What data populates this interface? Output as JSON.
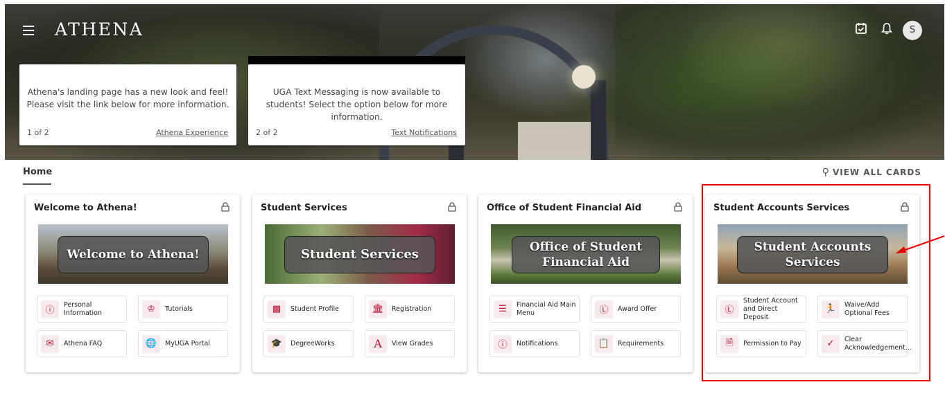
{
  "header": {
    "brand": "ATHENA",
    "avatar_initial": "S"
  },
  "announcements": [
    {
      "message": "Athena's landing page has a new look and feel! Please visit the link below for more information.",
      "count": "1 of 2",
      "link": "Athena Experience"
    },
    {
      "message": "UGA Text Messaging is now available to students! Select the option below for more information.",
      "count": "2 of 2",
      "link": "Text Notifications"
    }
  ],
  "tabs": {
    "home": "Home",
    "view_all": "VIEW ALL CARDS"
  },
  "accent_color": "#ba0c2f",
  "cards": [
    {
      "title": "Welcome to Athena!",
      "banner": "Welcome to Athena!",
      "links": [
        {
          "label": "Personal Information",
          "icon": "info-icon"
        },
        {
          "label": "Tutorials",
          "icon": "tutorial-icon"
        },
        {
          "label": "Athena FAQ",
          "icon": "chat-icon"
        },
        {
          "label": "MyUGA Portal",
          "icon": "globe-icon"
        }
      ]
    },
    {
      "title": "Student Services",
      "banner": "Student Services",
      "links": [
        {
          "label": "Student Profile",
          "icon": "id-card-icon"
        },
        {
          "label": "Registration",
          "icon": "institution-icon"
        },
        {
          "label": "DegreeWorks",
          "icon": "graduation-cap-icon"
        },
        {
          "label": "View Grades",
          "icon": "grade-icon"
        }
      ]
    },
    {
      "title": "Office of Student Financial Aid",
      "banner": "Office of Student Financial Aid",
      "links": [
        {
          "label": "Financial Aid Main Menu",
          "icon": "list-icon"
        },
        {
          "label": "Award Offer",
          "icon": "dollar-icon"
        },
        {
          "label": "Notifications",
          "icon": "info-icon"
        },
        {
          "label": "Requirements",
          "icon": "clipboard-icon"
        }
      ]
    },
    {
      "title": "Student Accounts Services",
      "banner": "Student Accounts Services",
      "links": [
        {
          "label": "Student Account and Direct Deposit",
          "icon": "dollar-icon"
        },
        {
          "label": "Waive/Add Optional Fees",
          "icon": "runner-icon"
        },
        {
          "label": "Permission to Pay",
          "icon": "document-icon"
        },
        {
          "label": "Clear Acknowledgement...",
          "icon": "checkmark-icon"
        }
      ]
    }
  ]
}
